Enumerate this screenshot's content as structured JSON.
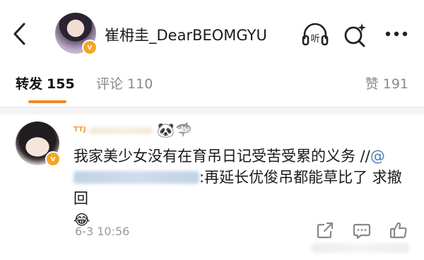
{
  "header": {
    "account_name": "崔枏圭_DearBEOMGYU",
    "verified_badge": "v",
    "back_icon": "chevron-left-icon",
    "listen_icon": "headphones-listen-icon",
    "listen_label": "听",
    "search_icon": "ai-search-icon",
    "more_icon": "more-dots-icon"
  },
  "tabs": [
    {
      "label": "转发",
      "count": "155",
      "active": true
    },
    {
      "label": "评论",
      "count": "110",
      "active": false
    },
    {
      "label": "赞",
      "count": "191",
      "active": false
    }
  ],
  "colors": {
    "accent": "#f08a24",
    "verified": "#f5a623",
    "mention": "#4a7db6",
    "muted": "#999999"
  },
  "comment": {
    "verified_badge": "v",
    "user_tag": "TTJ",
    "username_emojis": [
      "🐼",
      "🦈"
    ],
    "text_part1": "我家美少女没有在育吊日记受苦受累的义务 //",
    "mention_at": "@",
    "text_part2": ":再延长优俊吊都能草比了 求撤回",
    "end_emoji": "😂",
    "timestamp": "6-3 10:56",
    "actions": [
      "share-icon",
      "comment-icon",
      "thumbs-up-icon"
    ]
  }
}
